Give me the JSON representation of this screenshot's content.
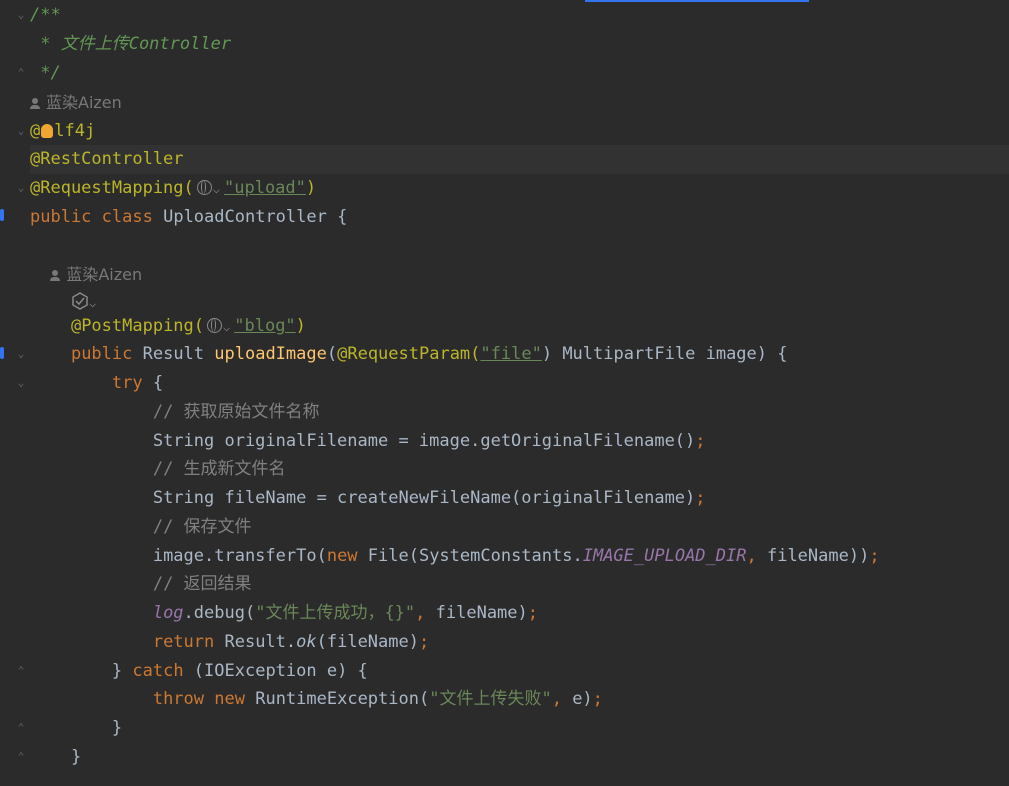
{
  "editor": {
    "author_hint": "蓝染Aizen",
    "lines": {
      "l1": "/**",
      "l2": " * 文件上传Controller",
      "l3": " */",
      "l5_prefix": "@",
      "l5_rest": "lf4j",
      "l6": "@RestController",
      "l7_ann": "@RequestMapping(",
      "l7_str": "\"upload\"",
      "l7_end": ")",
      "l8_public": "public",
      "l8_class": "class",
      "l8_name": " UploadController {",
      "l11_ann": "@PostMapping(",
      "l11_str": "\"blog\"",
      "l11_end": ")",
      "l12_public": "public",
      "l12_type": " Result ",
      "l12_method": "uploadImage",
      "l12_open": "(",
      "l12_ann": "@RequestParam",
      "l12_paren": "(",
      "l12_str": "\"file\"",
      "l12_rest": ") MultipartFile image) {",
      "l13_try": "try",
      "l13_rest": " {",
      "l14": "// 获取原始文件名称",
      "l15_code": "String originalFilename = image.getOriginalFilename()",
      "l15_semi": ";",
      "l16": "// 生成新文件名",
      "l17_code": "String fileName = createNewFileName(originalFilename)",
      "l17_semi": ";",
      "l18": "// 保存文件",
      "l19_a": "image.transferTo(",
      "l19_new": "new",
      "l19_b": " File(SystemConstants.",
      "l19_const": "IMAGE_UPLOAD_DIR",
      "l19_comma": ",",
      "l19_c": " fileName))",
      "l19_semi": ";",
      "l20": "// 返回结果",
      "l21_log": "log",
      "l21_a": ".debug(",
      "l21_str": "\"文件上传成功，{}\"",
      "l21_comma": ",",
      "l21_b": " fileName)",
      "l21_semi": ";",
      "l22_return": "return",
      "l22_a": " Result.",
      "l22_ok": "ok",
      "l22_b": "(fileName)",
      "l22_semi": ";",
      "l23_a": "} ",
      "l23_catch": "catch",
      "l23_b": " (IOException e) {",
      "l24_throw": "throw",
      "l24_new": "new",
      "l24_a": " RuntimeException(",
      "l24_str": "\"文件上传失败\"",
      "l24_comma": ",",
      "l24_b": " e)",
      "l24_semi": ";",
      "l25": "}",
      "l26": "}"
    }
  },
  "icons": {
    "globe": "globe-icon",
    "bulb": "lightbulb-icon",
    "user": "user-icon",
    "generate": "generate-icon"
  },
  "colors": {
    "background": "#2b2b2b",
    "annotation": "#bbb529",
    "keyword": "#cc7832",
    "string": "#6a8759",
    "doc_comment": "#629755",
    "comment": "#808080",
    "method": "#ffc66d",
    "constant": "#9876aa"
  }
}
